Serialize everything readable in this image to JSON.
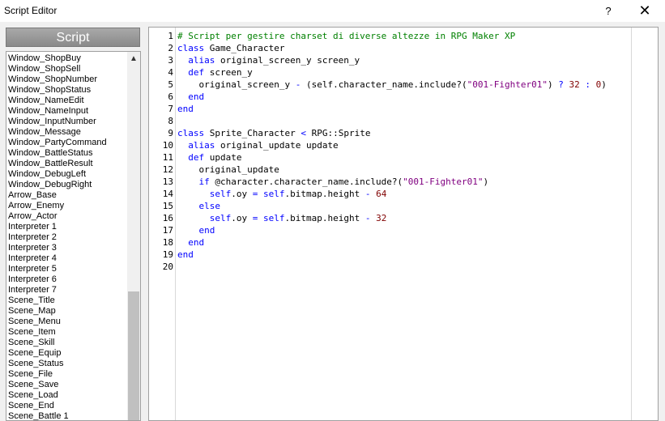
{
  "window": {
    "title": "Script Editor",
    "help_label": "?",
    "close_label": "✕"
  },
  "script_list": {
    "header": "Script",
    "items": [
      "Window_ShopBuy",
      "Window_ShopSell",
      "Window_ShopNumber",
      "Window_ShopStatus",
      "Window_NameEdit",
      "Window_NameInput",
      "Window_InputNumber",
      "Window_Message",
      "Window_PartyCommand",
      "Window_BattleStatus",
      "Window_BattleResult",
      "Window_DebugLeft",
      "Window_DebugRight",
      "Arrow_Base",
      "Arrow_Enemy",
      "Arrow_Actor",
      "Interpreter 1",
      "Interpreter 2",
      "Interpreter 3",
      "Interpreter 4",
      "Interpreter 5",
      "Interpreter 6",
      "Interpreter 7",
      "Scene_Title",
      "Scene_Map",
      "Scene_Menu",
      "Scene_Item",
      "Scene_Skill",
      "Scene_Equip",
      "Scene_Status",
      "Scene_File",
      "Scene_Save",
      "Scene_Load",
      "Scene_End",
      "Scene_Battle 1"
    ]
  },
  "editor": {
    "lines": [
      {
        "n": "1",
        "t": [
          [
            "cm",
            "# Script per gestire charset di diverse altezze in RPG Maker XP"
          ]
        ]
      },
      {
        "n": "2",
        "t": [
          [
            "kw",
            "class"
          ],
          [
            "",
            "Game_Character"
          ]
        ]
      },
      {
        "n": "3",
        "t": [
          [
            "kw",
            "  alias"
          ],
          [
            "",
            "original_screen_y screen_y"
          ]
        ]
      },
      {
        "n": "4",
        "t": [
          [
            "kw",
            "  def"
          ],
          [
            "",
            "screen_y"
          ]
        ]
      },
      {
        "n": "5",
        "t": [
          [
            "",
            "    original_screen_y "
          ],
          [
            "op",
            "-"
          ],
          [
            "",
            "(self.character_name.include?("
          ],
          [
            "st",
            "\"001-Fighter01\""
          ],
          [
            "",
            ") "
          ],
          [
            "op",
            "?"
          ],
          [
            "",
            ""
          ],
          [
            "nu",
            "32"
          ],
          [
            "",
            " "
          ],
          [
            "op",
            ":"
          ],
          [
            "",
            ""
          ],
          [
            "nu",
            "0"
          ],
          [
            "",
            ")"
          ]
        ]
      },
      {
        "n": "6",
        "t": [
          [
            "kw",
            "  end"
          ]
        ]
      },
      {
        "n": "7",
        "t": [
          [
            "kw",
            "end"
          ]
        ]
      },
      {
        "n": "8",
        "t": []
      },
      {
        "n": "9",
        "t": [
          [
            "kw",
            "class"
          ],
          [
            "",
            "Sprite_Character "
          ],
          [
            "op",
            "<"
          ],
          [
            "",
            " RPG::Sprite"
          ]
        ]
      },
      {
        "n": "10",
        "t": [
          [
            "kw",
            "  alias"
          ],
          [
            "",
            "original_update update"
          ]
        ]
      },
      {
        "n": "11",
        "t": [
          [
            "kw",
            "  def"
          ],
          [
            "",
            "update"
          ]
        ]
      },
      {
        "n": "12",
        "t": [
          [
            "",
            "    original_update"
          ]
        ]
      },
      {
        "n": "13",
        "t": [
          [
            "kw",
            "    if"
          ],
          [
            "",
            "@character.character_name.include?("
          ],
          [
            "st",
            "\"001-Fighter01\""
          ],
          [
            "",
            ")"
          ]
        ]
      },
      {
        "n": "14",
        "t": [
          [
            "sl",
            "      self"
          ],
          [
            "",
            ".oy "
          ],
          [
            "op",
            "="
          ],
          [
            "sl",
            "self"
          ],
          [
            "",
            ".bitmap.height "
          ],
          [
            "op",
            "-"
          ],
          [
            "",
            ""
          ],
          [
            "nu",
            "64"
          ]
        ]
      },
      {
        "n": "15",
        "t": [
          [
            "kw",
            "    else"
          ]
        ]
      },
      {
        "n": "16",
        "t": [
          [
            "sl",
            "      self"
          ],
          [
            "",
            ".oy "
          ],
          [
            "op",
            "="
          ],
          [
            "sl",
            "self"
          ],
          [
            "",
            ".bitmap.height "
          ],
          [
            "op",
            "-"
          ],
          [
            "",
            ""
          ],
          [
            "nu",
            "32"
          ]
        ]
      },
      {
        "n": "17",
        "t": [
          [
            "kw",
            "    end"
          ]
        ]
      },
      {
        "n": "18",
        "t": [
          [
            "kw",
            "  end"
          ]
        ]
      },
      {
        "n": "19",
        "t": [
          [
            "kw",
            "end"
          ]
        ]
      },
      {
        "n": "20",
        "t": []
      }
    ]
  }
}
